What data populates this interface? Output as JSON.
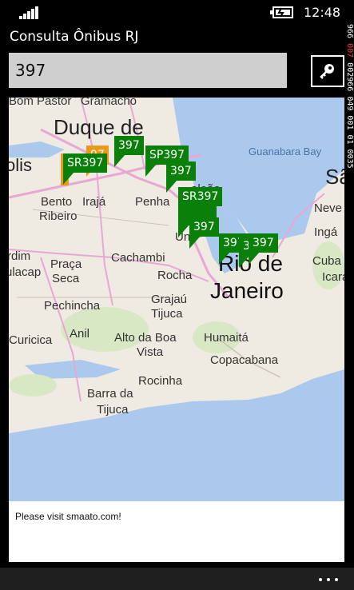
{
  "status_bar": {
    "time": "12:48",
    "signal_icon": "signal-bars-icon",
    "battery_icon": "battery-charging-icon"
  },
  "app": {
    "title": "Consulta Ônibus RJ"
  },
  "search": {
    "value": "397",
    "button_icon": "search-key-icon"
  },
  "side_strip": {
    "text_white": "966 ",
    "text_red": "007",
    "text_rest": " 002966 049 001 01 0035"
  },
  "map": {
    "places": [
      "Bom Pastor",
      "Gramacho",
      "Duque de",
      "olis",
      "Bento",
      "Ribeiro",
      "Irajá",
      "Penha",
      "rdim",
      "Praça",
      "Seca",
      "ulacap",
      "Cachambi",
      "Rocha",
      "Pechincha",
      "Grajaú",
      "Tijuca",
      "Curicica",
      "Anil",
      "Alto da Boa",
      "Vista",
      "Humaitá",
      "Copacabana",
      "Rocinha",
      "Barra da",
      "Tijuca",
      "Rio de",
      "Janeiro",
      "Sã",
      "Neve",
      "Cuba",
      "Ingá",
      "Icaraí",
      "Guanabara Bay",
      "aleão",
      "Un"
    ],
    "pins": [
      {
        "label": "SR397",
        "color": "green"
      },
      {
        "label": "97",
        "color": "orange"
      },
      {
        "label": "397",
        "color": "green"
      },
      {
        "label": "SP397",
        "color": "green"
      },
      {
        "label": "397",
        "color": "green"
      },
      {
        "label": "SR397",
        "color": "green"
      },
      {
        "label": "397",
        "color": "green"
      },
      {
        "label": "397",
        "color": "green"
      },
      {
        "label": "3",
        "color": "green"
      },
      {
        "label": "397",
        "color": "green"
      }
    ],
    "colors": {
      "land": "#efebe3",
      "water": "#aac9ec",
      "road": "#e7a8d3",
      "pin_green": "#0a7f0a",
      "pin_orange": "#e89a18"
    }
  },
  "ad": {
    "text": "Please visit smaato.com!"
  },
  "app_bar": {
    "more_icon": "more-ellipsis-icon"
  }
}
